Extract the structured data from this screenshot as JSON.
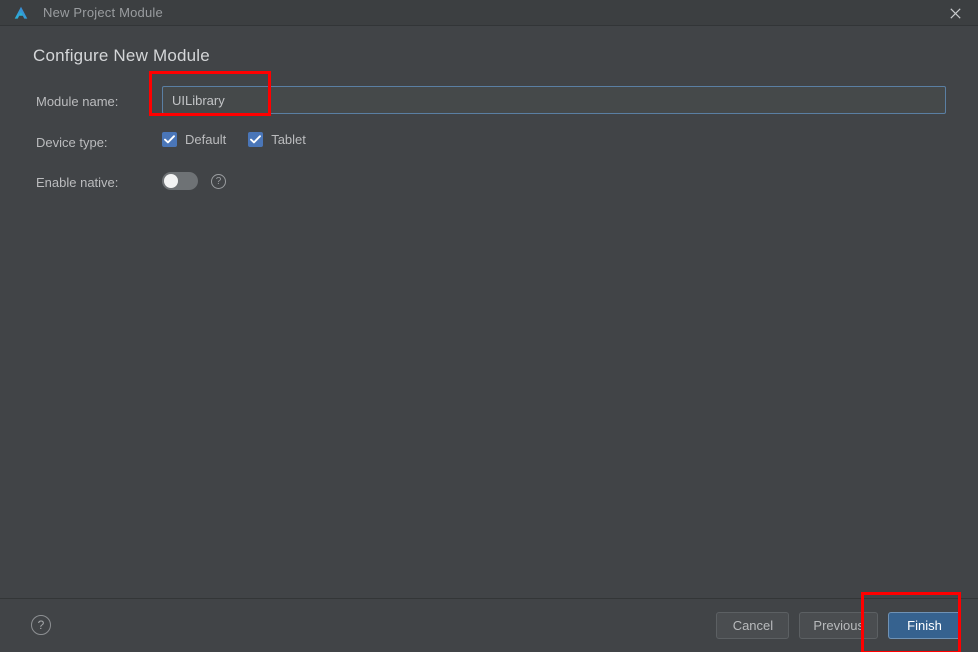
{
  "window": {
    "title": "New Project Module",
    "logo_icon": "android-studio-logo-icon",
    "close_icon": "close-icon"
  },
  "page": {
    "heading": "Configure New Module"
  },
  "form": {
    "module_name": {
      "label": "Module name:",
      "value": "UILibrary",
      "placeholder": ""
    },
    "device_type": {
      "label": "Device type:",
      "options": [
        {
          "label": "Default",
          "checked": true
        },
        {
          "label": "Tablet",
          "checked": true
        }
      ]
    },
    "enable_native": {
      "label": "Enable native:",
      "state": "off",
      "help_icon": "help-circle-icon"
    }
  },
  "footer": {
    "help_icon": "help-circle-icon",
    "buttons": [
      {
        "label": "Cancel",
        "style": "secondary"
      },
      {
        "label": "Previous",
        "style": "secondary"
      },
      {
        "label": "Finish",
        "style": "primary"
      }
    ]
  },
  "annotations": [
    {
      "name": "module-name-field-highlight",
      "color": "#ff0000"
    },
    {
      "name": "finish-button-highlight",
      "color": "#ff0000"
    }
  ],
  "colors": {
    "window_background": "#414447",
    "titlebar_background": "#3c3f41",
    "accent_blue": "#4a76b8",
    "primary_button": "#36628f",
    "annotation_red": "#ff0000",
    "text_primary": "#d4d6d8",
    "text_secondary": "#bbbcbe"
  }
}
